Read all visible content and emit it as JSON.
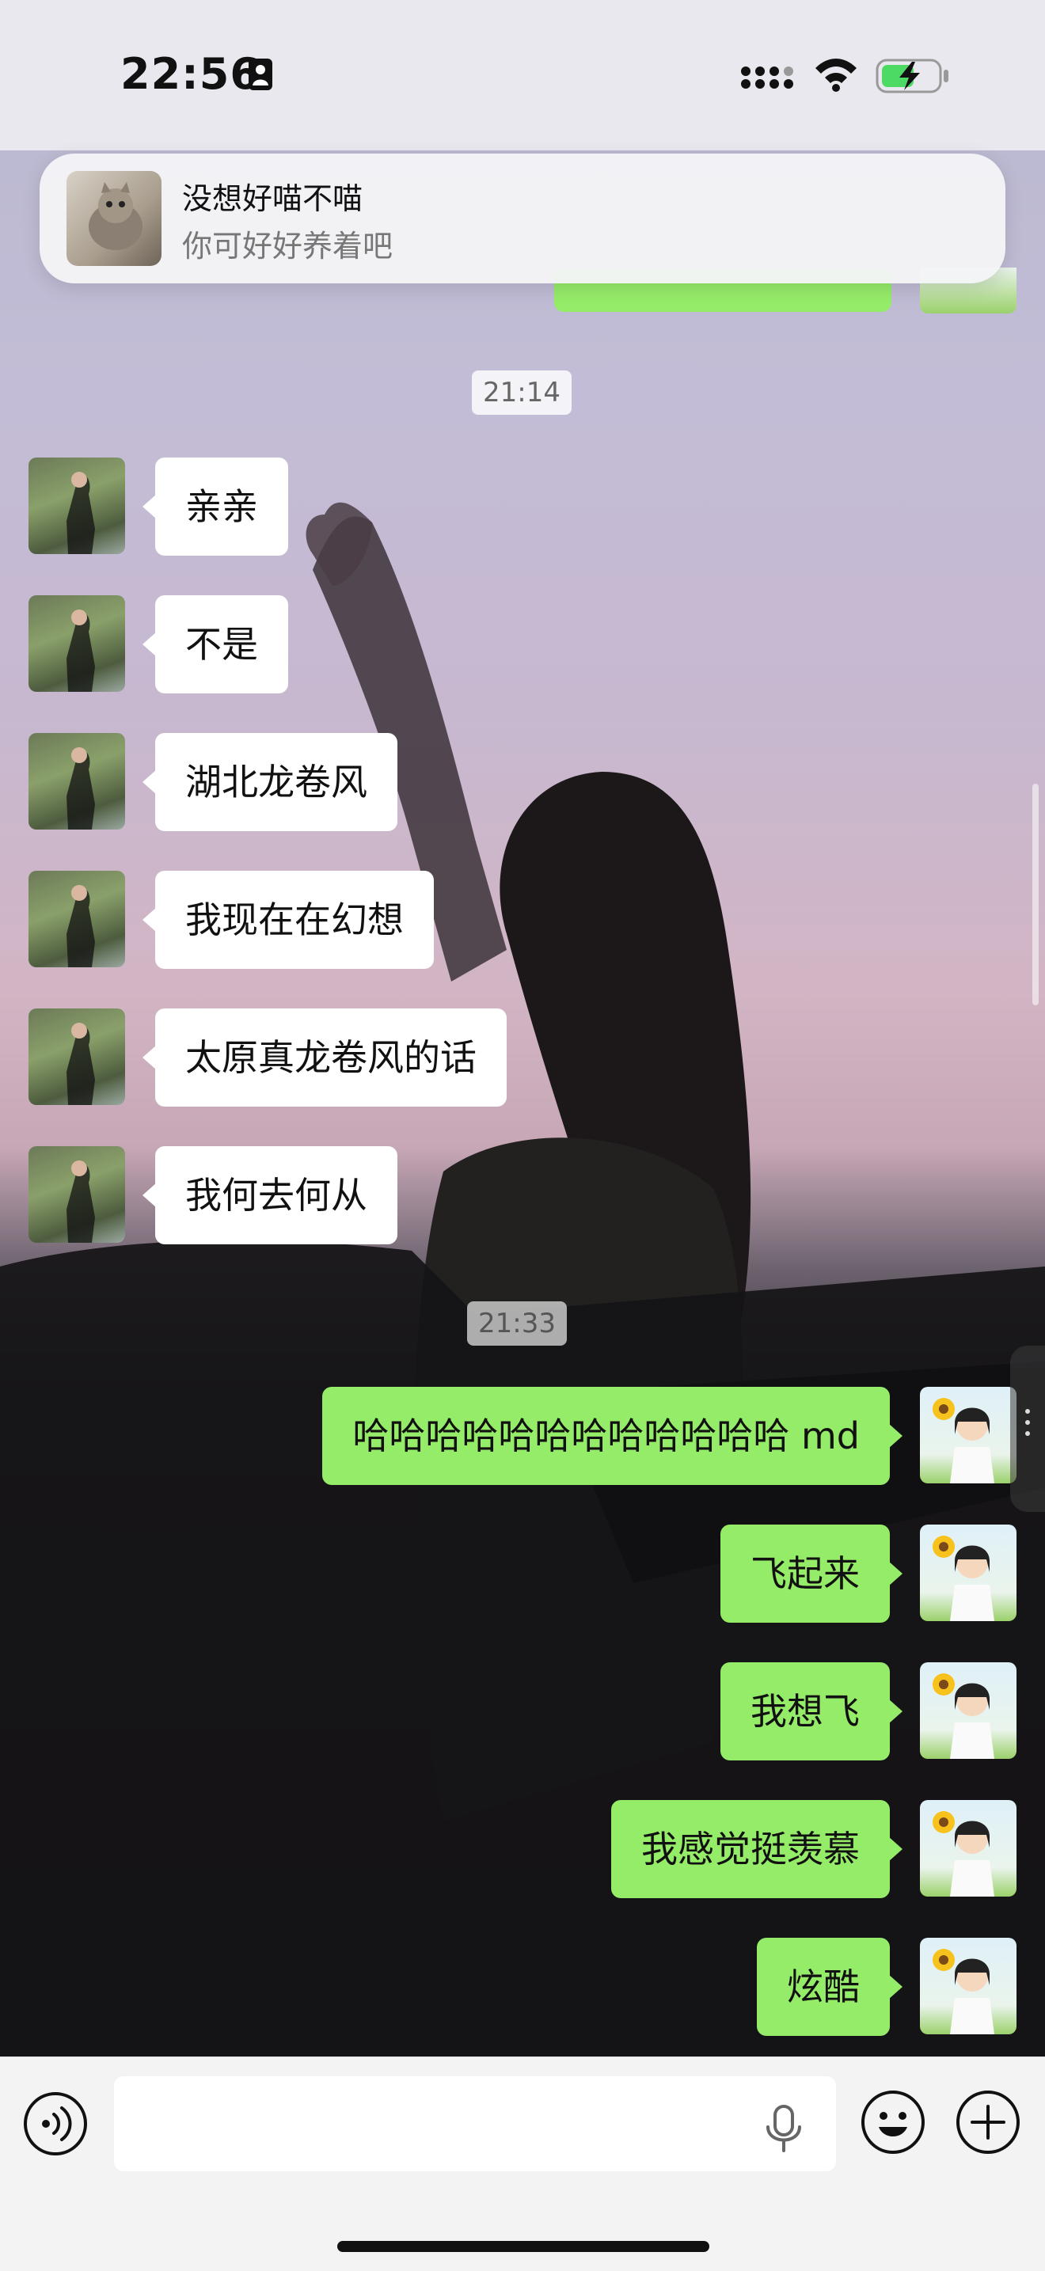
{
  "status_bar": {
    "time": "22:56"
  },
  "notification": {
    "title": "没想好喵不喵",
    "body": "你可好好养着吧"
  },
  "chat": {
    "timestamps": [
      "21:14",
      "21:33"
    ],
    "incoming_messages": [
      "亲亲",
      "不是",
      "湖北龙卷风",
      "我现在在幻想",
      "太原真龙卷风的话",
      "我何去何从"
    ],
    "outgoing_messages": [
      "哈哈哈哈哈哈哈哈哈哈哈哈 md",
      "飞起来",
      "我想飞",
      "我感觉挺羡慕",
      "炫酷"
    ]
  },
  "colors": {
    "outgoing_bubble": "#95ec69",
    "incoming_bubble": "#ffffff",
    "input_bar": "#f3f3f3"
  },
  "input_bar": {
    "left_icon": "voice-icon",
    "inner_icon": "microphone-icon",
    "right_icons": [
      "emoji-icon",
      "plus-icon"
    ]
  }
}
